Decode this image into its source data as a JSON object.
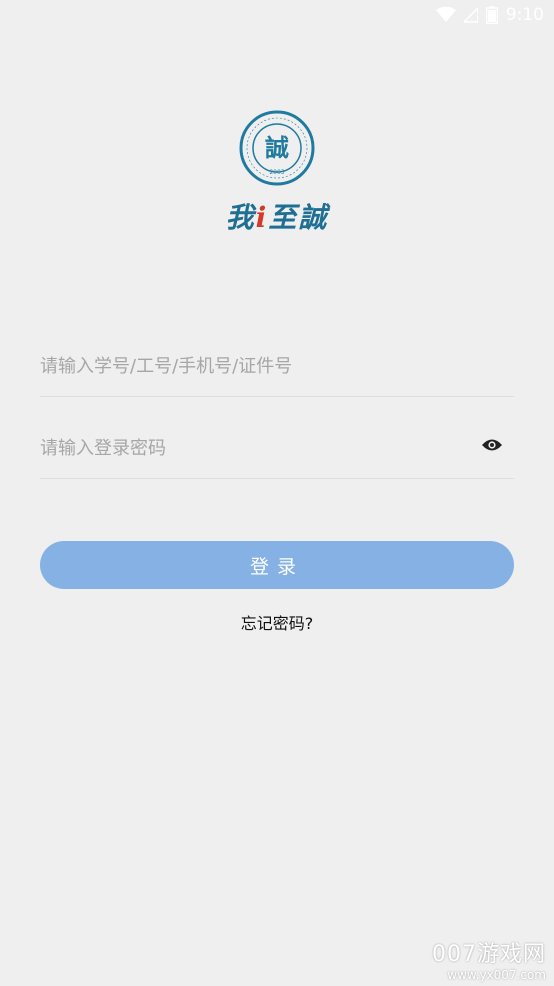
{
  "status_bar": {
    "time": "9:10",
    "icons": [
      "wifi-icon",
      "signal-icon",
      "battery-icon"
    ],
    "color": "#ffffff"
  },
  "logo": {
    "slogan_parts": [
      "我",
      "i",
      "至誠"
    ],
    "seal_year": "2003",
    "seal_center": "誠",
    "colors": {
      "seal": "#1f7aa0",
      "slogan": "#1e6f93",
      "dot": "#d23b2a"
    }
  },
  "form": {
    "username_placeholder": "请输入学号/工号/手机号/证件号",
    "password_placeholder": "请输入登录密码",
    "show_password_icon": "eye-icon",
    "login_label": "登录",
    "forgot_label": "忘记密码?"
  },
  "colors": {
    "background": "#efefef",
    "button": "#85b1e5",
    "placeholder": "#a6a6a6",
    "divider": "#dedede"
  },
  "watermark": {
    "main": "007游戏网",
    "url": "www.yx007.com"
  }
}
